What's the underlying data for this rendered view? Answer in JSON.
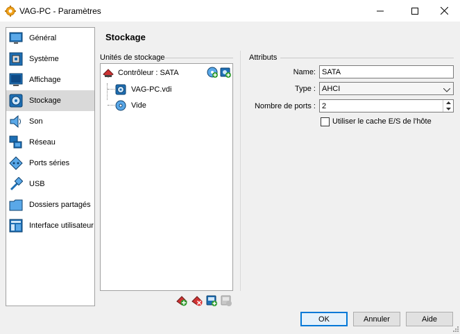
{
  "window": {
    "title": "VAG-PC - Paramètres",
    "icon": "virtualbox-gear-icon",
    "controls": [
      "minimize",
      "maximize",
      "close"
    ]
  },
  "sidebar": {
    "items": [
      {
        "label": "Général",
        "icon": "general-monitor-icon"
      },
      {
        "label": "Système",
        "icon": "system-chip-icon"
      },
      {
        "label": "Affichage",
        "icon": "display-monitor-icon"
      },
      {
        "label": "Stockage",
        "icon": "storage-disk-icon",
        "selected": true
      },
      {
        "label": "Son",
        "icon": "speaker-icon"
      },
      {
        "label": "Réseau",
        "icon": "network-icon"
      },
      {
        "label": "Ports séries",
        "icon": "serial-port-icon"
      },
      {
        "label": "USB",
        "icon": "usb-icon"
      },
      {
        "label": "Dossiers partagés",
        "icon": "shared-folder-icon"
      },
      {
        "label": "Interface utilisateur",
        "icon": "user-interface-icon"
      }
    ]
  },
  "page": {
    "title": "Stockage"
  },
  "storage": {
    "group_title": "Unités de stockage",
    "controller": {
      "label": "Contrôleur : SATA",
      "icon": "sata-controller-icon"
    },
    "controller_actions": [
      {
        "name": "add-optical-drive",
        "icon": "add-optical-drive-icon"
      },
      {
        "name": "add-hard-disk",
        "icon": "add-hard-disk-icon"
      }
    ],
    "devices": [
      {
        "label": "VAG-PC.vdi",
        "icon": "hard-disk-icon"
      },
      {
        "label": "Vide",
        "icon": "optical-disc-icon"
      }
    ],
    "toolbar": [
      {
        "name": "add-controller",
        "icon": "add-controller-icon",
        "enabled": true
      },
      {
        "name": "remove-controller",
        "icon": "remove-controller-icon",
        "enabled": true
      },
      {
        "name": "add-attachment",
        "icon": "add-attachment-icon",
        "enabled": true
      },
      {
        "name": "remove-attachment",
        "icon": "remove-attachment-icon",
        "enabled": false
      }
    ]
  },
  "attributes": {
    "group_title": "Attributs",
    "name_label": "Name:",
    "name_value": "SATA",
    "type_label": "Type :",
    "type_value": "AHCI",
    "ports_label": "Nombre de ports :",
    "ports_value": "2",
    "cache_label": "Utiliser le cache E/S de l'hôte",
    "cache_checked": false
  },
  "buttons": {
    "ok": "OK",
    "cancel": "Annuler",
    "help": "Aide"
  },
  "colors": {
    "selection": "#d9d9d9",
    "default_button_border": "#0078d7",
    "icon_blue": "#1e6fb4",
    "icon_green": "#2e9b2e"
  }
}
